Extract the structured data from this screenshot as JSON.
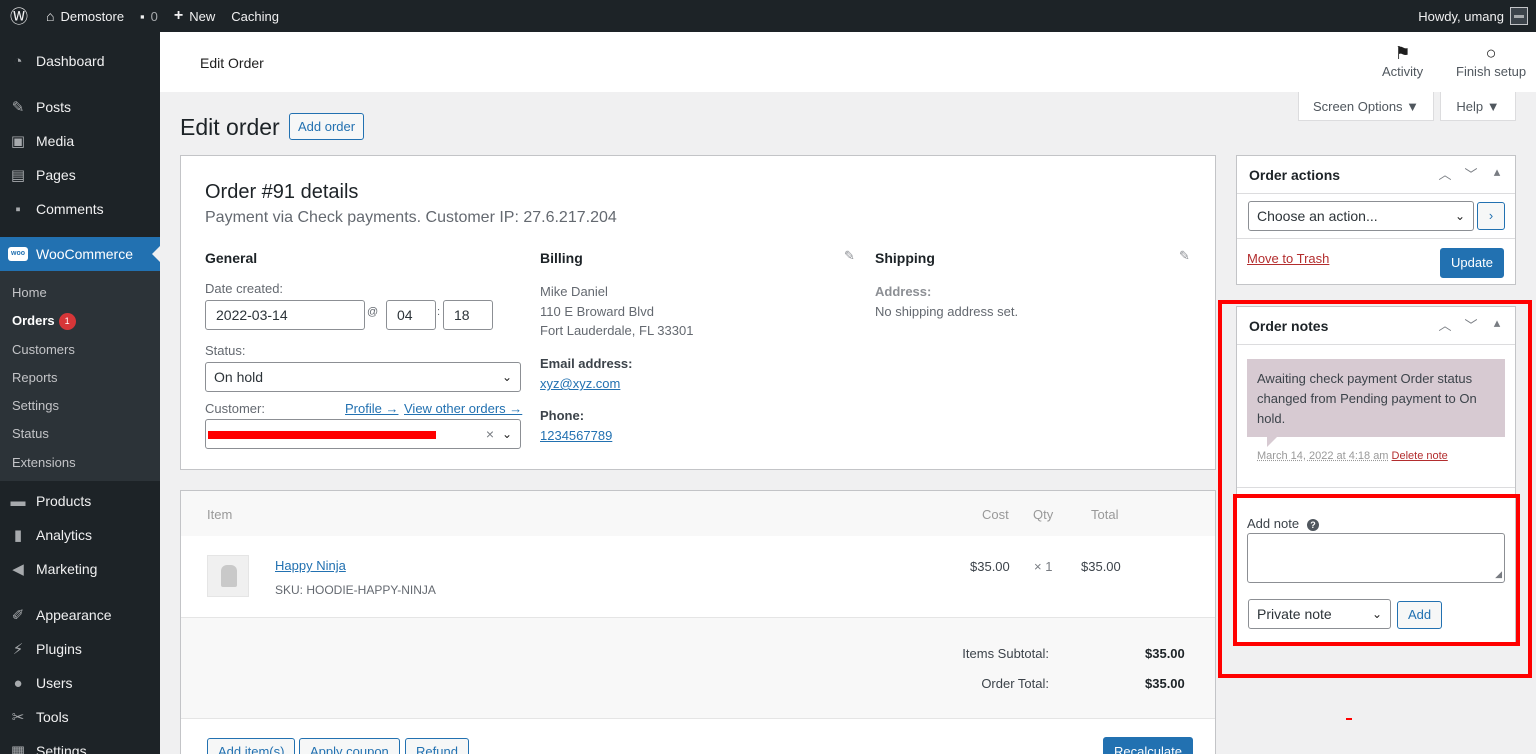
{
  "admin_bar": {
    "site_name": "Demostore",
    "comments_count": "0",
    "new_label": "New",
    "caching_label": "Caching",
    "howdy": "Howdy, umang",
    "wp_icon": "wordpress-logo-icon",
    "home_icon": "home-icon",
    "comment_icon": "comment-icon",
    "plus_icon": "plus-icon"
  },
  "sidebar": {
    "dashboard": "Dashboard",
    "posts": "Posts",
    "media": "Media",
    "pages": "Pages",
    "comments": "Comments",
    "woocommerce": "WooCommerce",
    "woo_logo": "woo",
    "submenu": {
      "home": "Home",
      "orders": "Orders",
      "orders_badge": "1",
      "customers": "Customers",
      "reports": "Reports",
      "settings": "Settings",
      "status": "Status",
      "extensions": "Extensions"
    },
    "products": "Products",
    "analytics": "Analytics",
    "marketing": "Marketing",
    "appearance": "Appearance",
    "plugins": "Plugins",
    "users": "Users",
    "tools": "Tools",
    "settings": "Settings"
  },
  "header": {
    "title": "Edit Order",
    "activity": "Activity",
    "finish_setup": "Finish setup"
  },
  "screen_options": {
    "label": "Screen Options ▼",
    "help": "Help ▼"
  },
  "page": {
    "title": "Edit order",
    "add_order": "Add order"
  },
  "order": {
    "title": "Order #91 details",
    "subtitle": "Payment via Check payments. Customer IP: 27.6.217.204",
    "general": {
      "heading": "General",
      "date_label": "Date created:",
      "date": "2022-03-14",
      "at": "@",
      "hour": "04",
      "colon": ":",
      "minute": "18",
      "status_label": "Status:",
      "status": "On hold",
      "customer_label": "Customer:",
      "profile_link": "Profile →",
      "other_orders_link": "View other orders →",
      "customer_clear": "×"
    },
    "billing": {
      "heading": "Billing",
      "name": "Mike Daniel",
      "address1": "110 E Broward Blvd",
      "address2": "Fort Lauderdale, FL 33301",
      "email_label": "Email address:",
      "email": "xyz@xyz.com",
      "phone_label": "Phone:",
      "phone": "1234567789"
    },
    "shipping": {
      "heading": "Shipping",
      "address_label": "Address:",
      "address": "No shipping address set."
    }
  },
  "items": {
    "headers": {
      "item": "Item",
      "cost": "Cost",
      "qty": "Qty",
      "total": "Total"
    },
    "rows": [
      {
        "name": "Happy Ninja",
        "sku": "SKU: HOODIE-HAPPY-NINJA",
        "cost": "$35.00",
        "qty": "× 1",
        "total": "$35.00"
      }
    ],
    "subtotal_label": "Items Subtotal:",
    "subtotal": "$35.00",
    "order_total_label": "Order Total:",
    "order_total": "$35.00",
    "add_items": "Add item(s)",
    "apply_coupon": "Apply coupon",
    "refund": "Refund",
    "recalculate": "Recalculate"
  },
  "order_actions": {
    "title": "Order actions",
    "select": "Choose an action...",
    "go": "›",
    "move_to_trash": "Move to Trash",
    "update": "Update"
  },
  "order_notes": {
    "title": "Order notes",
    "note_text": "Awaiting check payment Order status changed from Pending payment to On hold.",
    "note_date": "March 14, 2022 at 4:18 am",
    "delete_note": "Delete note",
    "add_note_label": "Add note",
    "help": "?",
    "note_type": "Private note",
    "add_button": "Add"
  },
  "colors": {
    "admin_dark": "#1d2327",
    "accent": "#2271b1",
    "highlight": "#ff0000",
    "note_bg": "#d7cad2"
  }
}
